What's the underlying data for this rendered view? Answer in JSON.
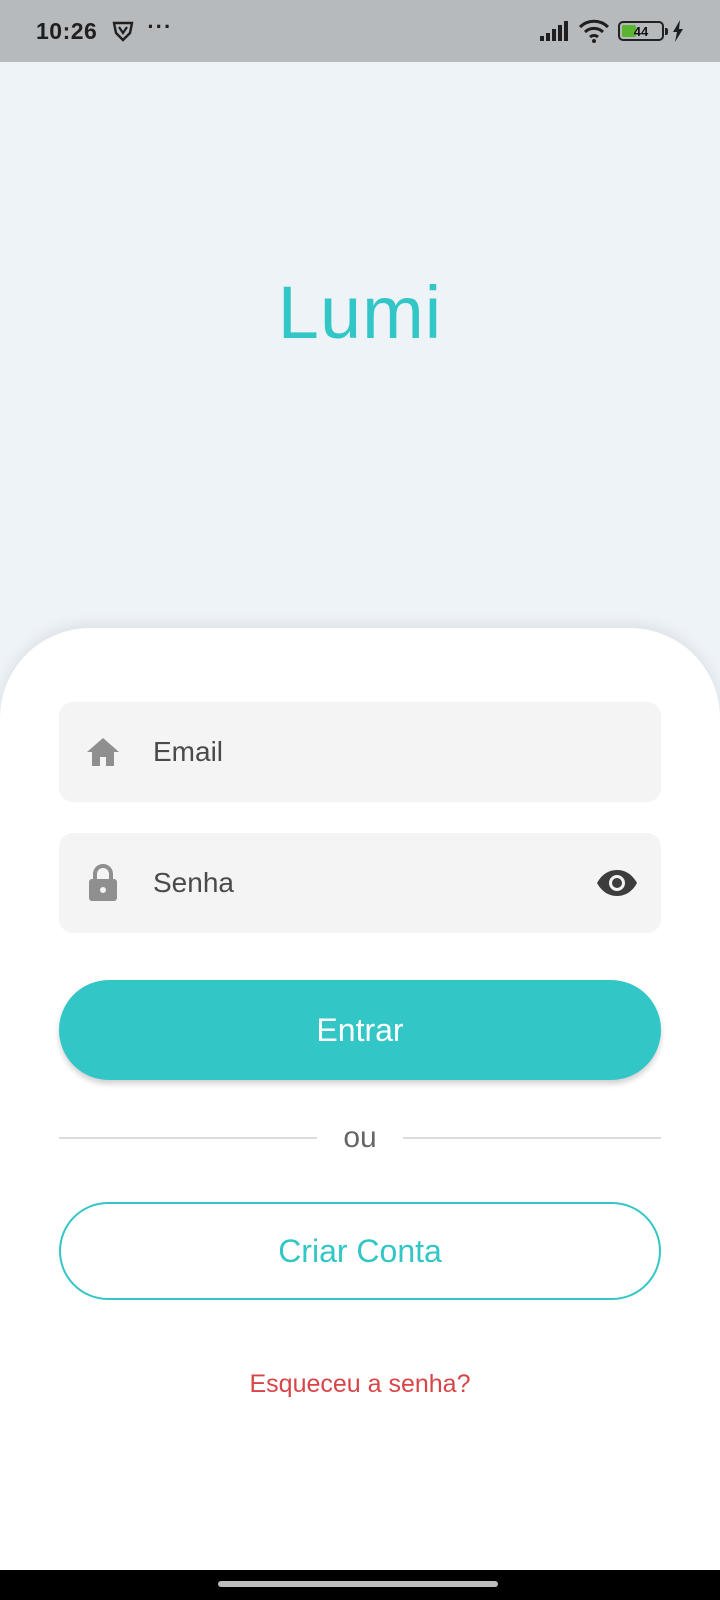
{
  "status_bar": {
    "time": "10:26",
    "more": "···",
    "battery_level": "44",
    "battery_fraction": 0.44,
    "icons": [
      "vpn-shield-icon",
      "signal-icon",
      "wifi-icon",
      "battery-icon",
      "charging-icon"
    ]
  },
  "brand": {
    "title": "Lumi",
    "color": "#33c6c6"
  },
  "form": {
    "email_placeholder": "Email",
    "password_placeholder": "Senha",
    "login_label": "Entrar",
    "divider_label": "ou",
    "create_account_label": "Criar Conta",
    "forgot_label": "Esqueceu a senha?"
  },
  "colors": {
    "accent": "#33c6c6",
    "danger": "#d84548",
    "background": "#eef3f7"
  }
}
